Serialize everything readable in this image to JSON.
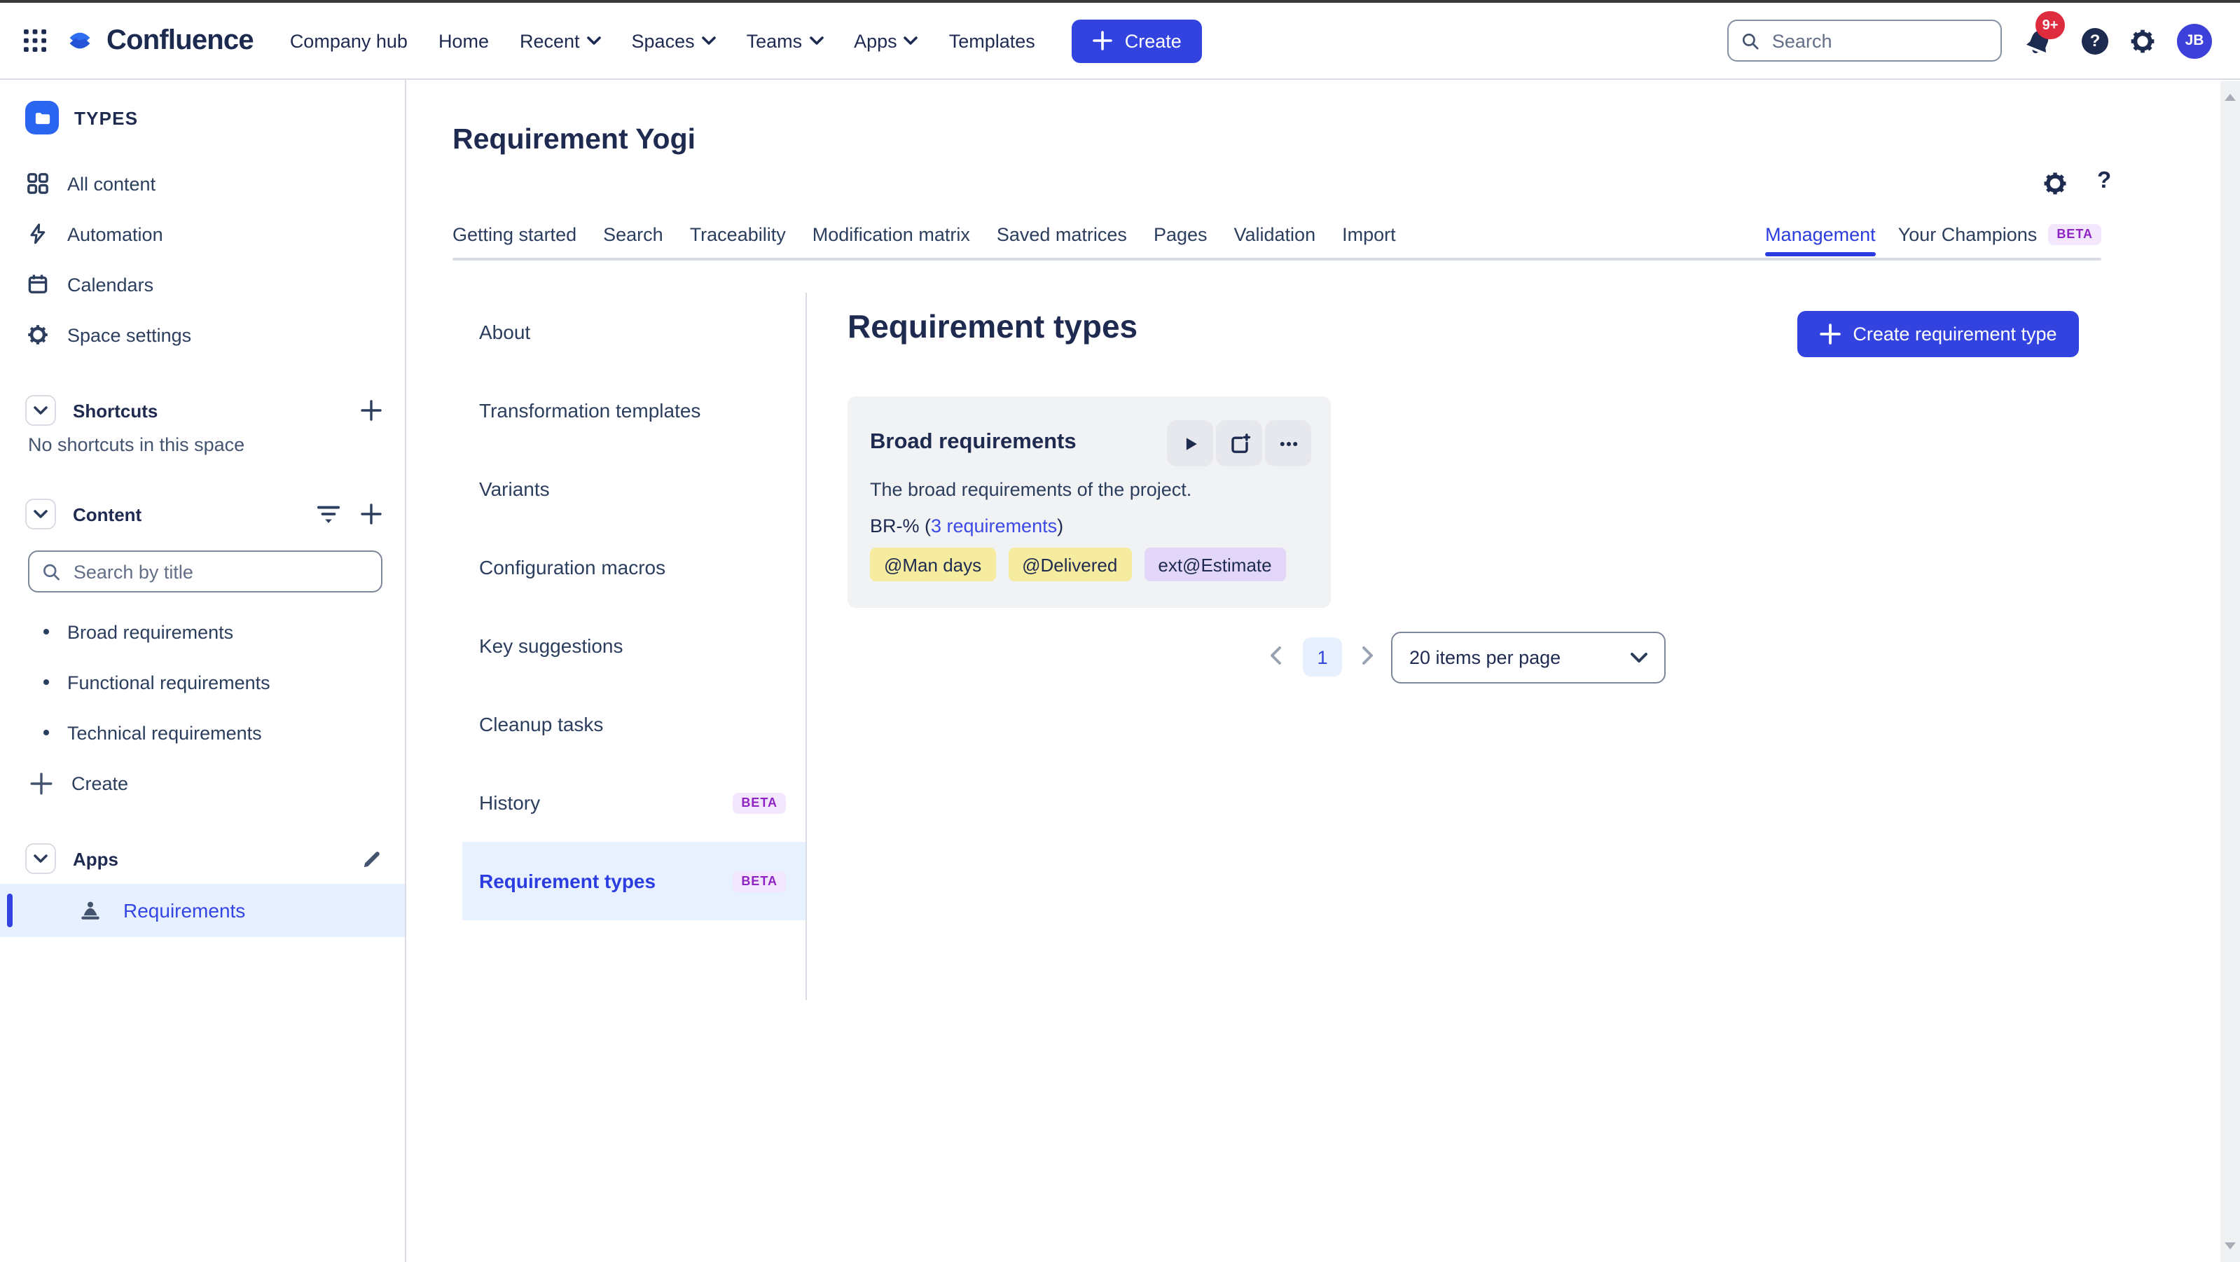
{
  "colors": {
    "accent_blue": "#3343e0",
    "navy_text": "#1f2a50",
    "beta_purple": "#8f24c4",
    "notification_red": "#de2b3e",
    "pill_yellow": "#f5ec9f",
    "pill_purple": "#e2d6f9",
    "active_item_bg": "#e8f1ff",
    "card_bg": "#f1f2f4"
  },
  "icons": {
    "app_switcher": "3x3-dot-grid",
    "logo_mark": "confluence-double-chevron",
    "search": "magnifier",
    "notifications": "bell",
    "help": "question-circle",
    "settings": "gear",
    "space_icon": "blue-folder-tile",
    "all_content": "2x2-grid",
    "automation": "lightning-bolt",
    "calendars": "calendar",
    "space_settings": "gear",
    "section_collapse": "chevron-down",
    "content_filter": "filter-lines",
    "add": "plus",
    "apps_edit": "pencil",
    "requirements_app": "meditating-person",
    "card_run": "play",
    "card_copy": "copy-plus",
    "card_more": "ellipsis",
    "pagination_prev": "chevron-left",
    "pagination_next": "chevron-right",
    "select_open": "chevron-down"
  },
  "top_nav": {
    "logo_text": "Confluence",
    "menu": [
      {
        "label": "Company hub",
        "dropdown": false
      },
      {
        "label": "Home",
        "dropdown": false
      },
      {
        "label": "Recent",
        "dropdown": true
      },
      {
        "label": "Spaces",
        "dropdown": true
      },
      {
        "label": "Teams",
        "dropdown": true
      },
      {
        "label": "Apps",
        "dropdown": true
      },
      {
        "label": "Templates",
        "dropdown": false
      }
    ],
    "create_label": "Create",
    "search_placeholder": "Search",
    "notification_count": "9+",
    "avatar_initials": "JB"
  },
  "sidebar": {
    "space_name": "TYPES",
    "nav": [
      {
        "label": "All content"
      },
      {
        "label": "Automation"
      },
      {
        "label": "Calendars"
      },
      {
        "label": "Space settings"
      }
    ],
    "shortcuts": {
      "title": "Shortcuts",
      "empty": "No shortcuts in this space"
    },
    "content": {
      "title": "Content",
      "search_placeholder": "Search by title",
      "pages": [
        {
          "label": "Broad requirements"
        },
        {
          "label": "Functional requirements"
        },
        {
          "label": "Technical requirements"
        }
      ],
      "create_label": "Create"
    },
    "apps": {
      "title": "Apps",
      "items": [
        {
          "label": "Requirements"
        }
      ]
    }
  },
  "main": {
    "page_title": "Requirement Yogi",
    "tabs": [
      {
        "label": "Getting started"
      },
      {
        "label": "Search"
      },
      {
        "label": "Traceability"
      },
      {
        "label": "Modification matrix"
      },
      {
        "label": "Saved matrices"
      },
      {
        "label": "Pages"
      },
      {
        "label": "Validation"
      },
      {
        "label": "Import"
      }
    ],
    "tabs_right": [
      {
        "label": "Management",
        "active": true
      },
      {
        "label": "Your Champions",
        "badge": "BETA"
      }
    ],
    "submenu": [
      {
        "label": "About"
      },
      {
        "label": "Transformation templates"
      },
      {
        "label": "Variants"
      },
      {
        "label": "Configuration macros"
      },
      {
        "label": "Key suggestions"
      },
      {
        "label": "Cleanup tasks"
      },
      {
        "label": "History",
        "badge": "BETA"
      },
      {
        "label": "Requirement types",
        "badge": "BETA",
        "active": true
      }
    ],
    "panel": {
      "heading": "Requirement types",
      "create_button": "Create requirement type",
      "card": {
        "title": "Broad requirements",
        "description": "The broad requirements of the project.",
        "key_text": "BR-% (",
        "link_text": "3 requirements",
        "key_suffix": ")",
        "labels": [
          {
            "text": "@Man days",
            "style": "yellow"
          },
          {
            "text": "@Delivered",
            "style": "yellow"
          },
          {
            "text": "ext@Estimate",
            "style": "purple"
          }
        ]
      },
      "pagination": {
        "current_page": "1",
        "items_per_page": "20 items per page"
      }
    }
  }
}
